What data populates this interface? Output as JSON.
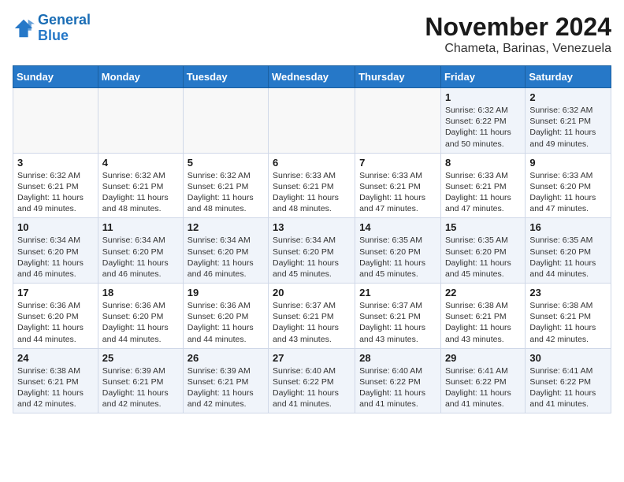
{
  "logo": {
    "line1": "General",
    "line2": "Blue"
  },
  "title": "November 2024",
  "location": "Chameta, Barinas, Venezuela",
  "weekdays": [
    "Sunday",
    "Monday",
    "Tuesday",
    "Wednesday",
    "Thursday",
    "Friday",
    "Saturday"
  ],
  "weeks": [
    [
      {
        "day": "",
        "info": ""
      },
      {
        "day": "",
        "info": ""
      },
      {
        "day": "",
        "info": ""
      },
      {
        "day": "",
        "info": ""
      },
      {
        "day": "",
        "info": ""
      },
      {
        "day": "1",
        "info": "Sunrise: 6:32 AM\nSunset: 6:22 PM\nDaylight: 11 hours and 50 minutes."
      },
      {
        "day": "2",
        "info": "Sunrise: 6:32 AM\nSunset: 6:21 PM\nDaylight: 11 hours and 49 minutes."
      }
    ],
    [
      {
        "day": "3",
        "info": "Sunrise: 6:32 AM\nSunset: 6:21 PM\nDaylight: 11 hours and 49 minutes."
      },
      {
        "day": "4",
        "info": "Sunrise: 6:32 AM\nSunset: 6:21 PM\nDaylight: 11 hours and 48 minutes."
      },
      {
        "day": "5",
        "info": "Sunrise: 6:32 AM\nSunset: 6:21 PM\nDaylight: 11 hours and 48 minutes."
      },
      {
        "day": "6",
        "info": "Sunrise: 6:33 AM\nSunset: 6:21 PM\nDaylight: 11 hours and 48 minutes."
      },
      {
        "day": "7",
        "info": "Sunrise: 6:33 AM\nSunset: 6:21 PM\nDaylight: 11 hours and 47 minutes."
      },
      {
        "day": "8",
        "info": "Sunrise: 6:33 AM\nSunset: 6:21 PM\nDaylight: 11 hours and 47 minutes."
      },
      {
        "day": "9",
        "info": "Sunrise: 6:33 AM\nSunset: 6:20 PM\nDaylight: 11 hours and 47 minutes."
      }
    ],
    [
      {
        "day": "10",
        "info": "Sunrise: 6:34 AM\nSunset: 6:20 PM\nDaylight: 11 hours and 46 minutes."
      },
      {
        "day": "11",
        "info": "Sunrise: 6:34 AM\nSunset: 6:20 PM\nDaylight: 11 hours and 46 minutes."
      },
      {
        "day": "12",
        "info": "Sunrise: 6:34 AM\nSunset: 6:20 PM\nDaylight: 11 hours and 46 minutes."
      },
      {
        "day": "13",
        "info": "Sunrise: 6:34 AM\nSunset: 6:20 PM\nDaylight: 11 hours and 45 minutes."
      },
      {
        "day": "14",
        "info": "Sunrise: 6:35 AM\nSunset: 6:20 PM\nDaylight: 11 hours and 45 minutes."
      },
      {
        "day": "15",
        "info": "Sunrise: 6:35 AM\nSunset: 6:20 PM\nDaylight: 11 hours and 45 minutes."
      },
      {
        "day": "16",
        "info": "Sunrise: 6:35 AM\nSunset: 6:20 PM\nDaylight: 11 hours and 44 minutes."
      }
    ],
    [
      {
        "day": "17",
        "info": "Sunrise: 6:36 AM\nSunset: 6:20 PM\nDaylight: 11 hours and 44 minutes."
      },
      {
        "day": "18",
        "info": "Sunrise: 6:36 AM\nSunset: 6:20 PM\nDaylight: 11 hours and 44 minutes."
      },
      {
        "day": "19",
        "info": "Sunrise: 6:36 AM\nSunset: 6:20 PM\nDaylight: 11 hours and 44 minutes."
      },
      {
        "day": "20",
        "info": "Sunrise: 6:37 AM\nSunset: 6:21 PM\nDaylight: 11 hours and 43 minutes."
      },
      {
        "day": "21",
        "info": "Sunrise: 6:37 AM\nSunset: 6:21 PM\nDaylight: 11 hours and 43 minutes."
      },
      {
        "day": "22",
        "info": "Sunrise: 6:38 AM\nSunset: 6:21 PM\nDaylight: 11 hours and 43 minutes."
      },
      {
        "day": "23",
        "info": "Sunrise: 6:38 AM\nSunset: 6:21 PM\nDaylight: 11 hours and 42 minutes."
      }
    ],
    [
      {
        "day": "24",
        "info": "Sunrise: 6:38 AM\nSunset: 6:21 PM\nDaylight: 11 hours and 42 minutes."
      },
      {
        "day": "25",
        "info": "Sunrise: 6:39 AM\nSunset: 6:21 PM\nDaylight: 11 hours and 42 minutes."
      },
      {
        "day": "26",
        "info": "Sunrise: 6:39 AM\nSunset: 6:21 PM\nDaylight: 11 hours and 42 minutes."
      },
      {
        "day": "27",
        "info": "Sunrise: 6:40 AM\nSunset: 6:22 PM\nDaylight: 11 hours and 41 minutes."
      },
      {
        "day": "28",
        "info": "Sunrise: 6:40 AM\nSunset: 6:22 PM\nDaylight: 11 hours and 41 minutes."
      },
      {
        "day": "29",
        "info": "Sunrise: 6:41 AM\nSunset: 6:22 PM\nDaylight: 11 hours and 41 minutes."
      },
      {
        "day": "30",
        "info": "Sunrise: 6:41 AM\nSunset: 6:22 PM\nDaylight: 11 hours and 41 minutes."
      }
    ]
  ]
}
